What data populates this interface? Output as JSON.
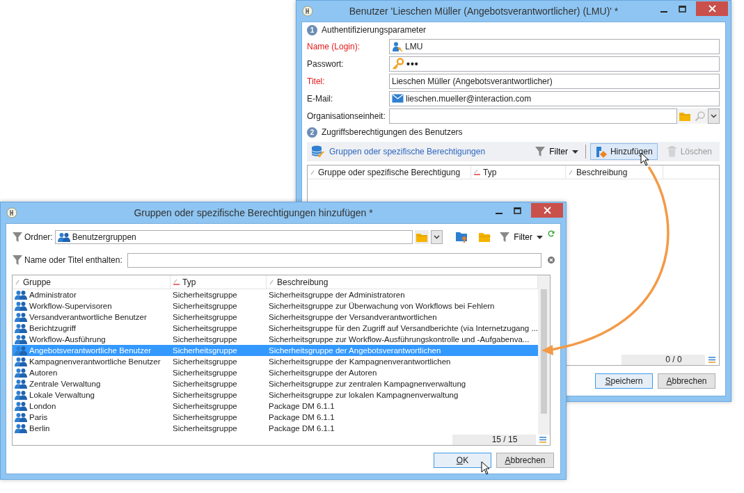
{
  "user_window": {
    "title": "Benutzer 'Lieschen Müller (Angebotsverantwortlicher) (LMU)' *",
    "sections": [
      {
        "number": "1",
        "title": "Authentifizierungsparameter"
      },
      {
        "number": "2",
        "title": "Zugriffsberechtigungen des Benutzers"
      }
    ],
    "fields": [
      {
        "label": "Name (Login):",
        "required": true,
        "kind": "login",
        "value": "LMU"
      },
      {
        "label": "Passwort:",
        "required": false,
        "kind": "password",
        "value": "•••"
      },
      {
        "label": "Titel:",
        "required": true,
        "kind": "text",
        "value": "Lieschen Müller (Angebotsverantwortlicher)"
      },
      {
        "label": "E-Mail:",
        "required": false,
        "kind": "email",
        "value": "lieschen.mueller@interaction.com"
      },
      {
        "label": "Organisationseinheit:",
        "required": false,
        "kind": "link"
      }
    ],
    "toolbar": {
      "title": "Gruppen oder spezifische Berechtigungen",
      "filter": "Filter",
      "add": {
        "label": "Hinzufügen",
        "hovered": true
      },
      "delete": {
        "label": "Löschen",
        "disabled": true
      }
    },
    "table": {
      "columns": [
        {
          "label": "Gruppe oder spezifische Berechtigung",
          "sorted": false
        },
        {
          "label": "Typ",
          "sorted": true
        },
        {
          "label": "Beschreibung",
          "sorted": false
        }
      ],
      "count": "0 / 0"
    },
    "buttons": [
      {
        "label": "Speichern",
        "focused": true
      },
      {
        "label": "Abbrechen",
        "focused": false
      }
    ]
  },
  "add_dialog": {
    "title": "Gruppen oder spezifische Berechtigungen hinzufügen *",
    "folder": {
      "label": "Ordner:",
      "value": "Benutzergruppen"
    },
    "filter": "Filter",
    "search": {
      "label": "Name oder Titel enthalten:"
    },
    "table": {
      "columns": [
        {
          "label": "Gruppe",
          "sorted": false
        },
        {
          "label": "Typ",
          "sorted": true
        },
        {
          "label": "Beschreibung",
          "sorted": false
        }
      ],
      "rows": [
        {
          "group": "Administrator",
          "type": "Sicherheitsgruppe",
          "description": "Sicherheitsgruppe der Administratoren",
          "selected": false
        },
        {
          "group": "Workflow-Supervisoren",
          "type": "Sicherheitsgruppe",
          "description": "Sicherheitsgruppe zur Überwachung von Workflows bei Fehlern",
          "selected": false
        },
        {
          "group": "Versandverantwortliche Benutzer",
          "type": "Sicherheitsgruppe",
          "description": "Sicherheitsgruppe der Versandverantwortlichen",
          "selected": false
        },
        {
          "group": "Berichtzugriff",
          "type": "Sicherheitsgruppe",
          "description": "Sicherheitsgruppe für den Zugriff auf Versandberichte (via Internetzugang ...",
          "selected": false
        },
        {
          "group": "Workflow-Ausführung",
          "type": "Sicherheitsgruppe",
          "description": "Sicherheitsgruppe zur Workflow-Ausführungskontrolle und -Aufgabenva...",
          "selected": false
        },
        {
          "group": "Angebotsverantwortliche Benutzer",
          "type": "Sicherheitsgruppe",
          "description": "Sicherheitsgruppe der Angebotsverantwortlichen",
          "selected": true
        },
        {
          "group": "Kampagnenverantwortliche Benutzer",
          "type": "Sicherheitsgruppe",
          "description": "Sicherheitsgruppe der Kampagnenverantwortlichen",
          "selected": false
        },
        {
          "group": "Autoren",
          "type": "Sicherheitsgruppe",
          "description": "Sicherheitsgruppe der Autoren",
          "selected": false
        },
        {
          "group": "Zentrale Verwaltung",
          "type": "Sicherheitsgruppe",
          "description": "Sicherheitsgruppe zur zentralen Kampagnenverwaltung",
          "selected": false
        },
        {
          "group": "Lokale Verwaltung",
          "type": "Sicherheitsgruppe",
          "description": "Sicherheitsgruppe zur lokalen Kampagnenverwaltung",
          "selected": false
        },
        {
          "group": "London",
          "type": "Sicherheitsgruppe",
          "description": "Package DM 6.1.1",
          "selected": false
        },
        {
          "group": "Paris",
          "type": "Sicherheitsgruppe",
          "description": "Package DM 6.1.1",
          "selected": false
        },
        {
          "group": "Berlin",
          "type": "Sicherheitsgruppe",
          "description": "Package DM 6.1.1",
          "selected": false
        }
      ],
      "count": "15 / 15"
    },
    "buttons": [
      {
        "label": "OK",
        "focused": true
      },
      {
        "label": "Abbrechen",
        "focused": false
      }
    ]
  }
}
